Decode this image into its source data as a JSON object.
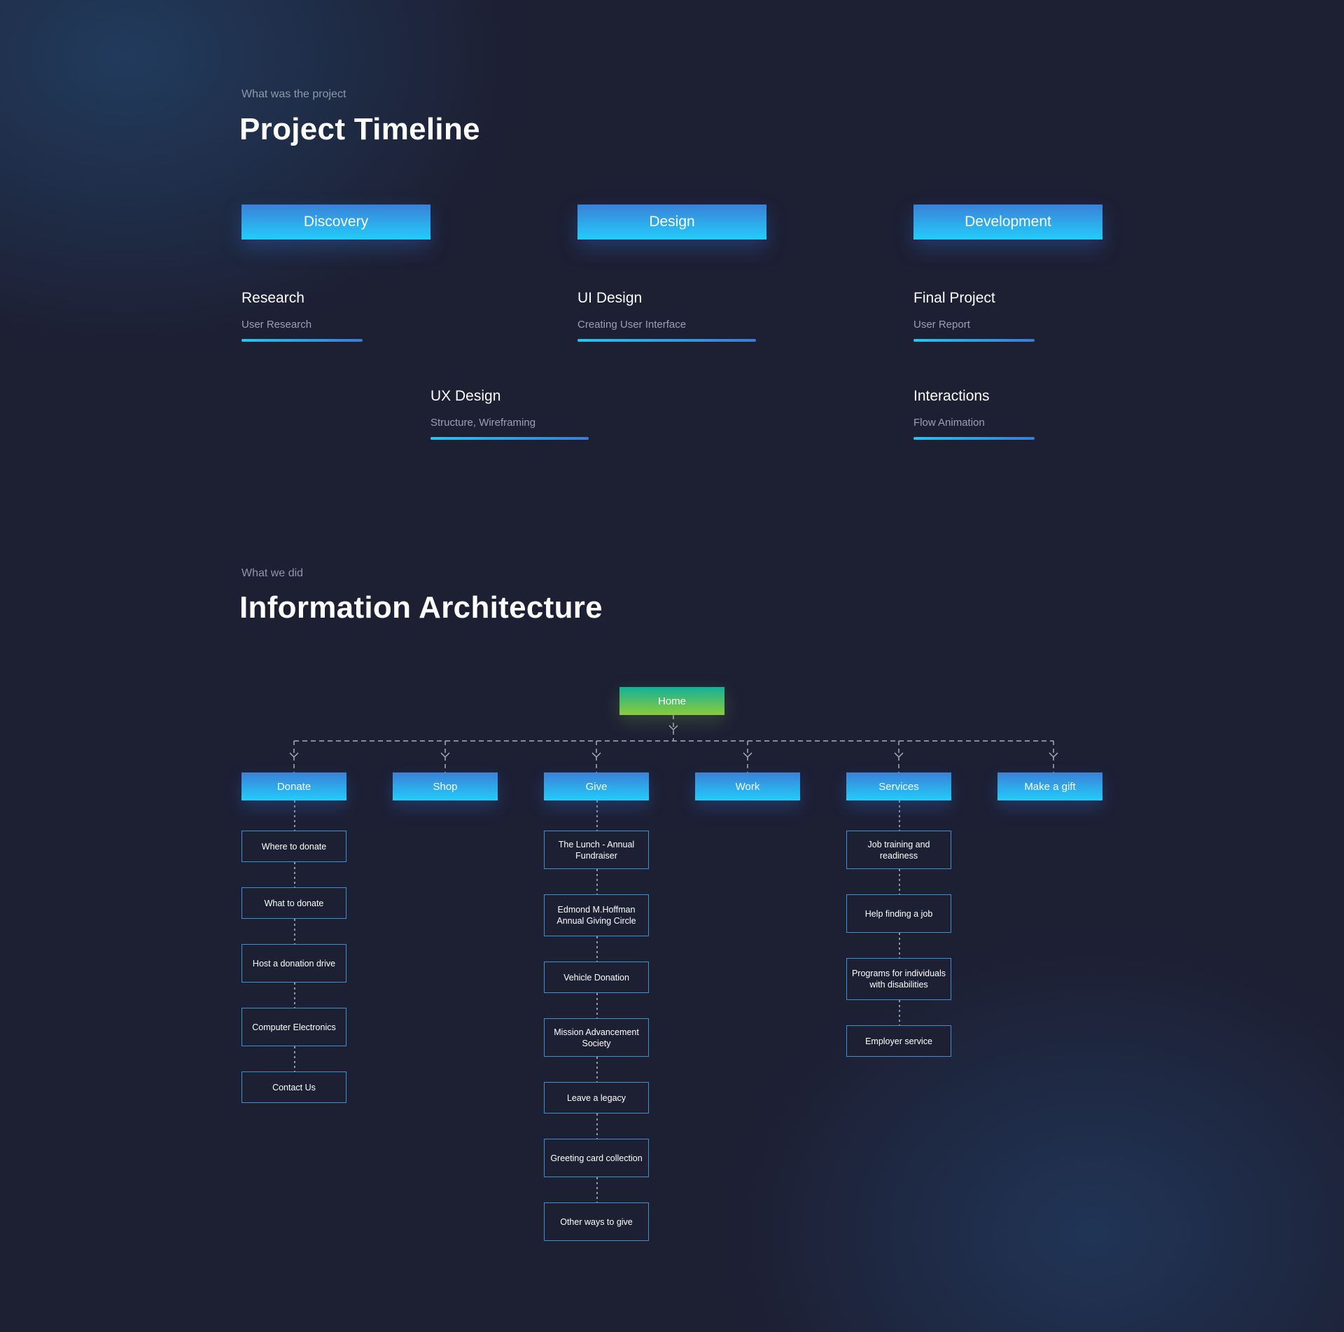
{
  "timeline": {
    "eyebrow": "What was the project",
    "title": "Project Timeline",
    "phases": [
      {
        "label": "Discovery"
      },
      {
        "label": "Design"
      },
      {
        "label": "Development"
      }
    ],
    "items": [
      {
        "title": "Research",
        "subtitle": "User Research"
      },
      {
        "title": "UI Design",
        "subtitle": "Creating User Interface"
      },
      {
        "title": "Final Project",
        "subtitle": "User Report"
      },
      {
        "title": "UX Design",
        "subtitle": "Structure, Wireframing"
      },
      {
        "title": "Interactions",
        "subtitle": "Flow Animation"
      }
    ]
  },
  "ia": {
    "eyebrow": "What we did",
    "title": "Information Architecture",
    "home": "Home",
    "nav": [
      {
        "label": "Donate",
        "children": [
          "Where to donate",
          "What to donate",
          "Host a donation drive",
          "Computer Electronics",
          "Contact Us"
        ]
      },
      {
        "label": "Shop",
        "children": []
      },
      {
        "label": "Give",
        "children": [
          "The Lunch - Annual Fundraiser",
          "Edmond M.Hoffman Annual Giving Circle",
          "Vehicle Donation",
          "Mission Advancement Society",
          "Leave a legacy",
          "Greeting card collection",
          "Other ways to give"
        ]
      },
      {
        "label": "Work",
        "children": []
      },
      {
        "label": "Services",
        "children": [
          "Job training and readiness",
          "Help finding a job",
          "Programs for individuals with disabilities",
          "Employer service"
        ]
      },
      {
        "label": "Make a gift",
        "children": []
      }
    ]
  },
  "colors": {
    "background": "#1d1f33",
    "accent_blue_top": "#3b80d8",
    "accent_blue_bottom": "#23cdfb",
    "home_green_top": "#12b199",
    "home_green_bottom": "#8ccb3a",
    "box_border": "#3d8fd6"
  }
}
